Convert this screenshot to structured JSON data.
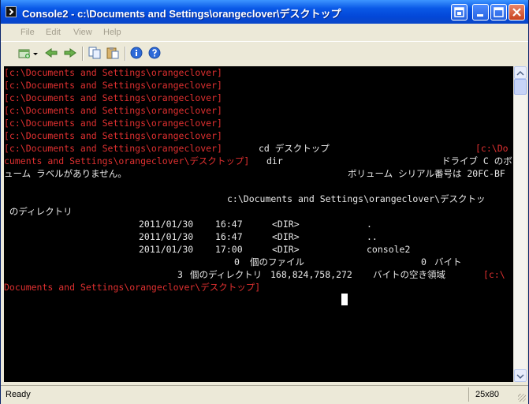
{
  "window": {
    "title": "Console2 - c:\\Documents and Settings\\orangeclover\\デスクトップ"
  },
  "menu": {
    "items": [
      "File",
      "Edit",
      "View",
      "Help"
    ]
  },
  "toolbar": {
    "icons": [
      "new-tab-icon",
      "dropdown-arrow-icon",
      "previous-tab-icon",
      "next-tab-icon",
      "copy-icon",
      "paste-icon",
      "help-icon",
      "about-icon"
    ]
  },
  "console": {
    "lines": [
      {
        "text": "[c:\\Documents and Settings\\orangeclover]",
        "color": "red"
      },
      {
        "text": "[c:\\Documents and Settings\\orangeclover]",
        "color": "red"
      },
      {
        "text": "[c:\\Documents and Settings\\orangeclover]",
        "color": "red"
      },
      {
        "text": "[c:\\Documents and Settings\\orangeclover]",
        "color": "red"
      },
      {
        "text": "[c:\\Documents and Settings\\orangeclover]",
        "color": "red"
      },
      {
        "text": "[c:\\Documents and Settings\\orangeclover]",
        "color": "red"
      },
      {
        "prompt": "[c:\\Documents and Settings\\orangeclover]",
        "command": "cd デスクトップ",
        "tail": "[c:\\Do"
      },
      {
        "prompt": "cuments and Settings\\orangeclover\\デスクトップ]",
        "command": "dir",
        "tail": "ドライブ C のボ"
      },
      {
        "text": "ューム ラベルがありません。",
        "tail": "ボリューム シリアル番号は 20FC-BF"
      },
      {
        "text": ""
      },
      {
        "text": "c:\\Documents and Settings\\orangeclover\\デスクトッ"
      },
      {
        "text": " のディレクトリ"
      },
      {
        "date": "2011/01/30",
        "time": "16:47",
        "type": "<DIR>",
        "name": "."
      },
      {
        "date": "2011/01/30",
        "time": "16:47",
        "type": "<DIR>",
        "name": ".."
      },
      {
        "date": "2011/01/30",
        "time": "17:00",
        "type": "<DIR>",
        "name": "console2"
      },
      {
        "count": "0",
        "label": "個のファイル",
        "bytes": "0",
        "unit": "バイト"
      },
      {
        "count": "3",
        "label": "個のディレクトリ",
        "bytes": "168,824,758,272",
        "unit": "バイトの空き領域",
        "tail": "[c:\\"
      },
      {
        "text": "Documents and Settings\\orangeclover\\デスクトップ]",
        "color": "red"
      }
    ]
  },
  "status": {
    "left": "Ready",
    "right": "25x80"
  }
}
